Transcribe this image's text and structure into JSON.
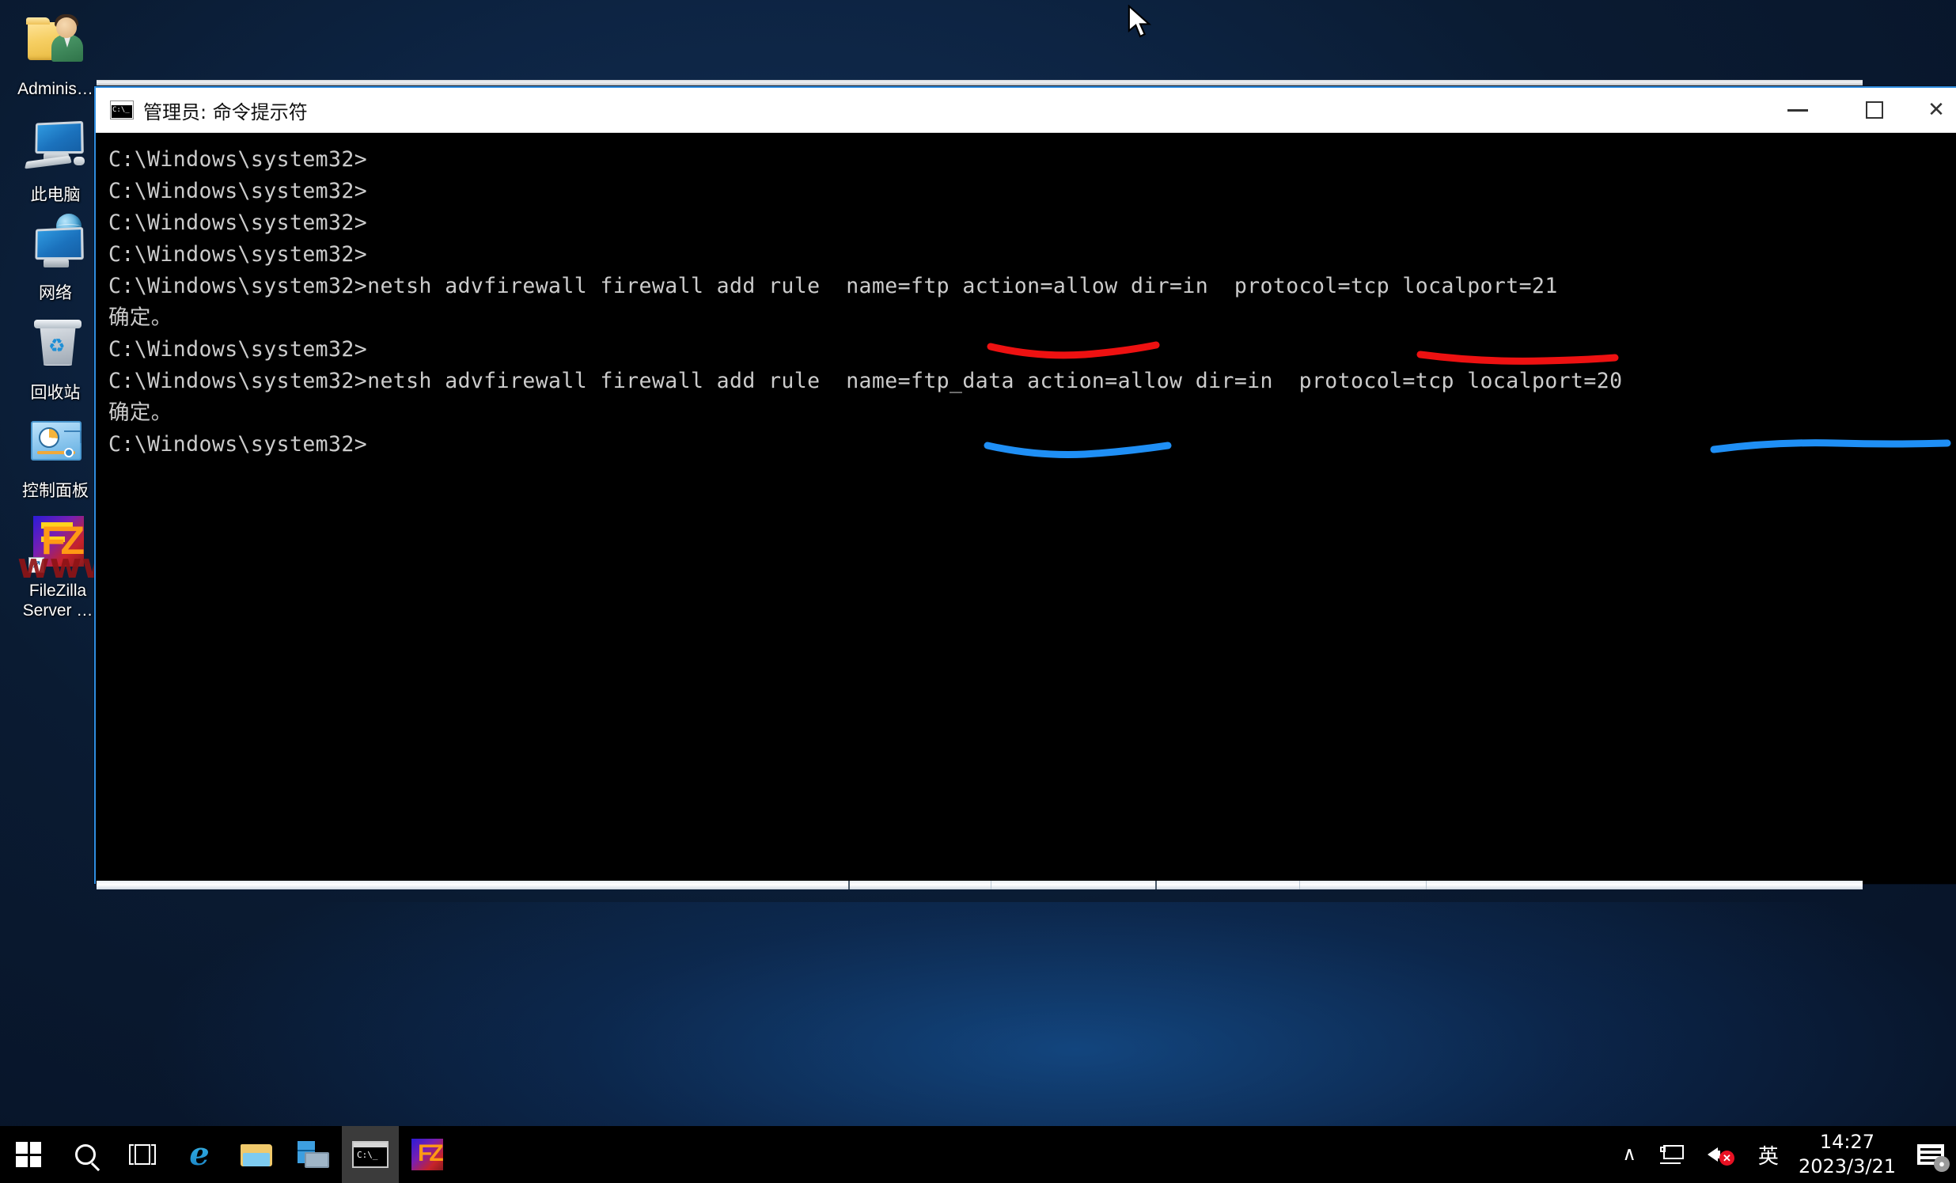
{
  "desktop": {
    "icons": [
      {
        "name": "administrator-folder",
        "label": "Adminis…"
      },
      {
        "name": "this-pc",
        "label": "此电脑"
      },
      {
        "name": "network",
        "label": "网络"
      },
      {
        "name": "recycle-bin",
        "label": "回收站"
      },
      {
        "name": "control-panel",
        "label": "控制面板"
      },
      {
        "name": "filezilla-server",
        "label": "FileZilla\nServer …"
      }
    ],
    "watermark": "www.iterx.cn"
  },
  "window": {
    "title": "管理员: 命令提示符",
    "icon": "cmd-icon",
    "controls": {
      "minimize": "—",
      "maximize": "☐",
      "close": "✕"
    }
  },
  "console": {
    "lines": [
      "C:\\Windows\\system32>",
      "C:\\Windows\\system32>",
      "C:\\Windows\\system32>",
      "C:\\Windows\\system32>",
      "C:\\Windows\\system32>netsh advfirewall firewall add rule  name=ftp action=allow dir=in  protocol=tcp localport=21",
      "确定。",
      "",
      "C:\\Windows\\system32>",
      "C:\\Windows\\system32>netsh advfirewall firewall add rule  name=ftp_data action=allow dir=in  protocol=tcp localport=20",
      "确定。",
      "",
      "C:\\Windows\\system32>"
    ],
    "foreground": "#cccccc",
    "background": "#000000"
  },
  "annotations": [
    {
      "name": "red-underline-name-ftp",
      "color": "#ee1111",
      "target": "name=ftp"
    },
    {
      "name": "red-underline-localport-21",
      "color": "#ee1111",
      "target": "localport=21"
    },
    {
      "name": "blue-underline-name-ftp-data",
      "color": "#1f8ff5",
      "target": "name=ftp_data"
    },
    {
      "name": "blue-underline-localport-20",
      "color": "#1f8ff5",
      "target": "localport=20"
    }
  ],
  "taskbar": {
    "items": [
      {
        "name": "start-button",
        "label": "start-icon"
      },
      {
        "name": "search-button",
        "label": "search-icon"
      },
      {
        "name": "task-view-button",
        "label": "task-view-icon"
      },
      {
        "name": "internet-explorer",
        "label": "internet-explorer-icon"
      },
      {
        "name": "file-explorer",
        "label": "file-explorer-icon"
      },
      {
        "name": "server-manager",
        "label": "server-manager-icon"
      },
      {
        "name": "command-prompt",
        "label": "cmd-icon",
        "active": true
      },
      {
        "name": "filezilla-server",
        "label": "filezilla-icon"
      }
    ],
    "tray": {
      "chevron": "∧",
      "network": "network-icon",
      "volume": "volume-muted-icon",
      "ime": "英",
      "time": "14:27",
      "date": "2023/3/21",
      "notifications": "notification-icon"
    }
  }
}
